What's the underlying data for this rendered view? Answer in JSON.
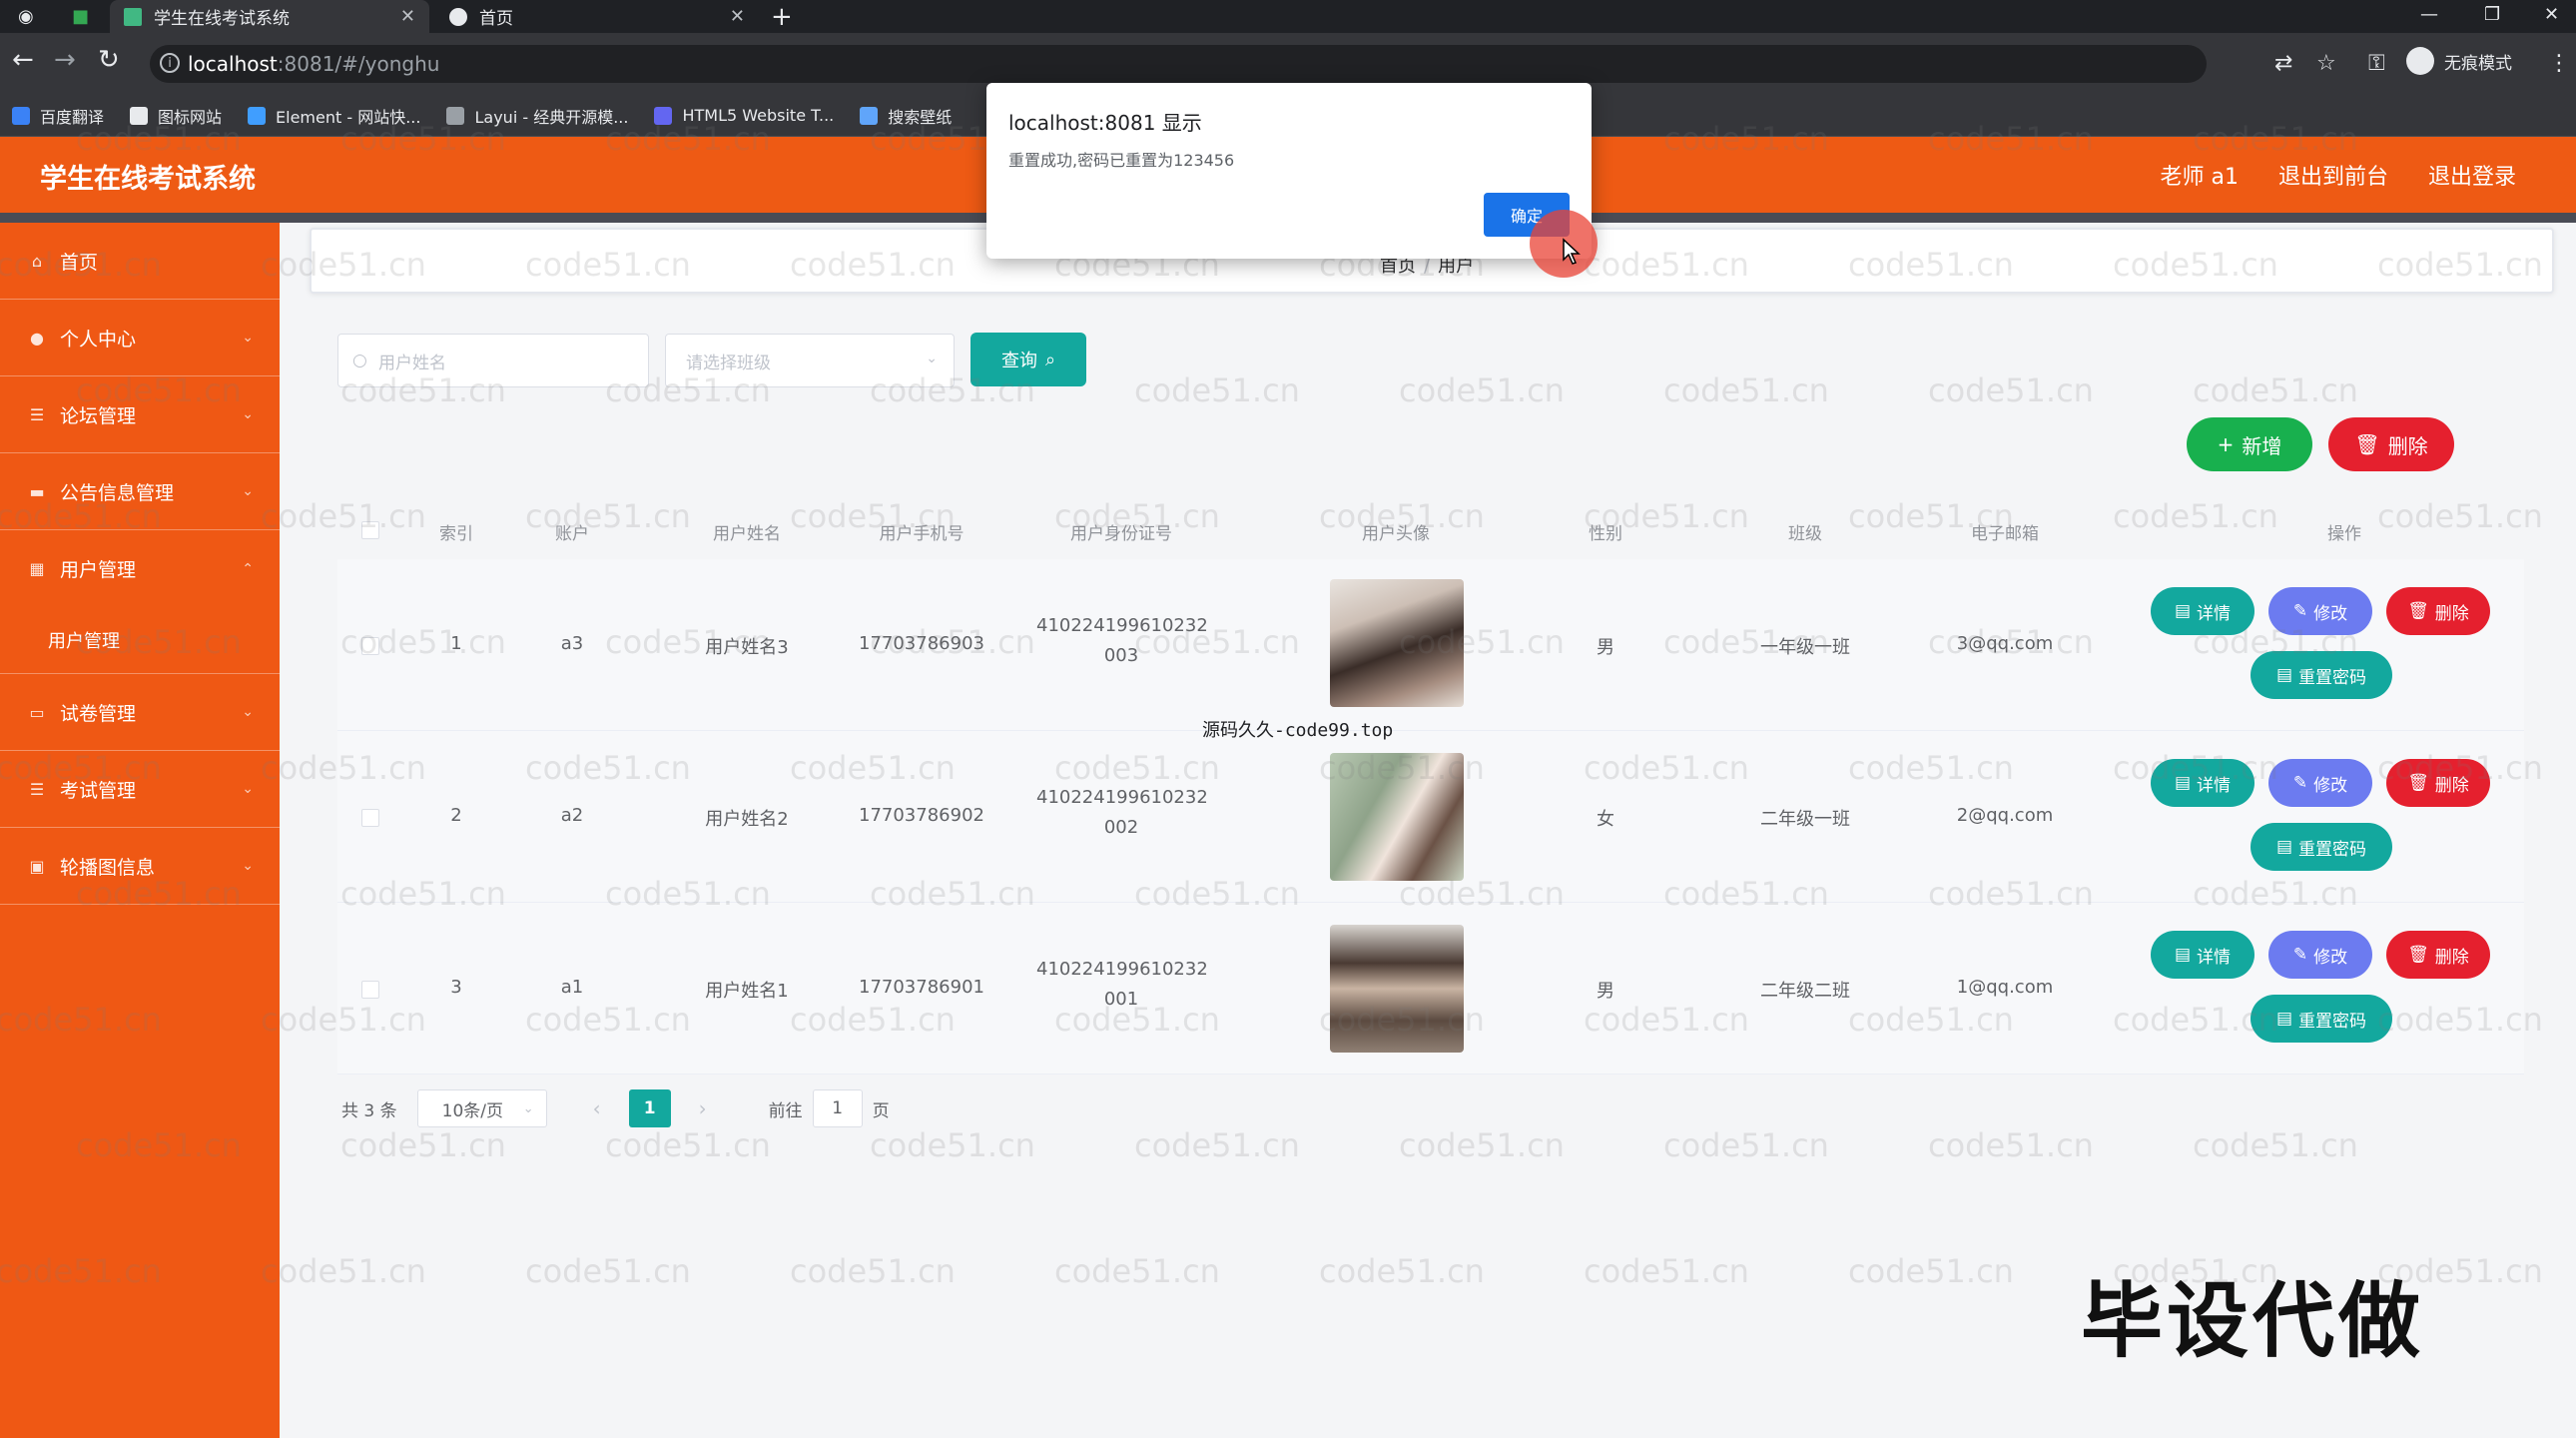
{
  "browser": {
    "tabs": [
      {
        "title": "学生在线考试系统",
        "active": true
      },
      {
        "title": "首页",
        "active": false
      }
    ],
    "url_host": "localhost",
    "url_path": ":8081/#/yonghu",
    "bookmarks": [
      "百度翻译",
      "图标网站",
      "Element - 网站快...",
      "Layui - 经典开源模...",
      "HTML5 Website T...",
      "搜索壁纸"
    ],
    "incognito_label": "无痕模式"
  },
  "header": {
    "title": "学生在线考试系统",
    "links": [
      "老师 a1",
      "退出到前台",
      "退出登录"
    ],
    "color": "#ee5a14"
  },
  "sidebar": {
    "items": [
      {
        "label": "首页",
        "icon": "home-icon"
      },
      {
        "label": "个人中心",
        "icon": "user-icon"
      },
      {
        "label": "论坛管理",
        "icon": "list-icon"
      },
      {
        "label": "公告信息管理",
        "icon": "message-icon"
      },
      {
        "label": "用户管理",
        "icon": "grid-icon"
      },
      {
        "label": "用户管理",
        "icon": "",
        "sub": true
      },
      {
        "label": "试卷管理",
        "icon": "monitor-icon"
      },
      {
        "label": "考试管理",
        "icon": "list-icon"
      },
      {
        "label": "轮播图信息",
        "icon": "apps-icon"
      }
    ]
  },
  "breadcrumb": {
    "home": "首页",
    "current": "用户"
  },
  "search": {
    "name_placeholder": "用户姓名",
    "class_placeholder": "请选择班级",
    "query_label": "查询"
  },
  "actions": {
    "add_label": "新增",
    "delete_label": "删除"
  },
  "table": {
    "headers": [
      "索引",
      "账户",
      "用户姓名",
      "用户手机号",
      "用户身份证号",
      "用户头像",
      "性别",
      "班级",
      "电子邮箱",
      "操作"
    ],
    "rows": [
      {
        "index": "1",
        "account": "a3",
        "name": "用户姓名3",
        "phone": "17703786903",
        "id_line1": "410224199610232",
        "id_line2": "003",
        "gender": "男",
        "class": "一年级一班",
        "email": "3@qq.com"
      },
      {
        "index": "2",
        "account": "a2",
        "name": "用户姓名2",
        "phone": "17703786902",
        "id_line1": "410224199610232",
        "id_line2": "002",
        "gender": "女",
        "class": "二年级一班",
        "email": "2@qq.com"
      },
      {
        "index": "3",
        "account": "a1",
        "name": "用户姓名1",
        "phone": "17703786901",
        "id_line1": "410224199610232",
        "id_line2": "001",
        "gender": "男",
        "class": "二年级二班",
        "email": "1@qq.com"
      }
    ],
    "op_labels": {
      "detail": "详情",
      "edit": "修改",
      "delete": "删除",
      "reset": "重置密码"
    }
  },
  "pagination": {
    "total": "共 3 条",
    "page_size": "10条/页",
    "current_page": "1",
    "goto_prefix": "前往",
    "goto_value": "1",
    "goto_suffix": "页"
  },
  "alert": {
    "title": "localhost:8081 显示",
    "message": "重置成功,密码已重置为123456",
    "ok_label": "确定"
  },
  "watermarks": {
    "site": "code51.cn",
    "source": "源码久久-code99.top",
    "banner": "毕设代做"
  }
}
